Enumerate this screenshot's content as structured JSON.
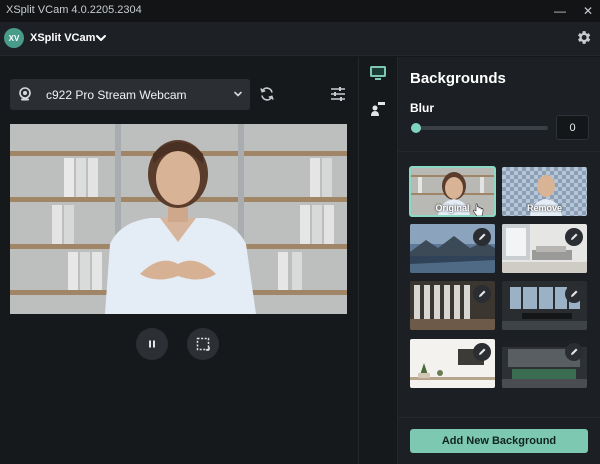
{
  "window": {
    "title": "XSplit VCam 4.0.2205.2304",
    "minimize_glyph": "—",
    "close_glyph": "✕"
  },
  "app": {
    "avatar_initials": "XV",
    "name": "XSplit VCam",
    "icons": {
      "menu": "chevron-down-icon",
      "settings": "gear-icon"
    }
  },
  "camera": {
    "selected": "c922 Pro Stream Webcam",
    "icons": [
      "webcam-icon",
      "chevron-down-icon",
      "refresh-icon",
      "sliders-icon"
    ]
  },
  "preview": {
    "controls": [
      {
        "name": "pause-button",
        "icon": "pause-icon"
      },
      {
        "name": "crop-button",
        "icon": "crop-icon"
      }
    ]
  },
  "tabs": [
    {
      "name": "tab-backgrounds",
      "icon": "monitor-icon",
      "active": true
    },
    {
      "name": "tab-person",
      "icon": "person-icon",
      "active": false
    }
  ],
  "backgrounds": {
    "title": "Backgrounds",
    "blur": {
      "label": "Blur",
      "value": "0",
      "level": 0
    },
    "items": [
      {
        "name": "bg-original",
        "label": "Original",
        "selected": true,
        "editable": false
      },
      {
        "name": "bg-remove",
        "label": "Remove",
        "selected": false,
        "editable": false
      },
      {
        "name": "bg-mountain-lake",
        "label": "",
        "selected": false,
        "editable": true
      },
      {
        "name": "bg-living-room",
        "label": "",
        "selected": false,
        "editable": true
      },
      {
        "name": "bg-office-windows",
        "label": "",
        "selected": false,
        "editable": true
      },
      {
        "name": "bg-conference-room",
        "label": "",
        "selected": false,
        "editable": true
      },
      {
        "name": "bg-plant-shelf",
        "label": "",
        "selected": false,
        "editable": true
      },
      {
        "name": "bg-modern-office",
        "label": "",
        "selected": false,
        "editable": true
      }
    ],
    "add_button": "Add New Background"
  },
  "colors": {
    "accent": "#7dc8b0",
    "selected_outline": "#8cd9c3",
    "panel": "#1c1f23",
    "background": "#16191c"
  }
}
